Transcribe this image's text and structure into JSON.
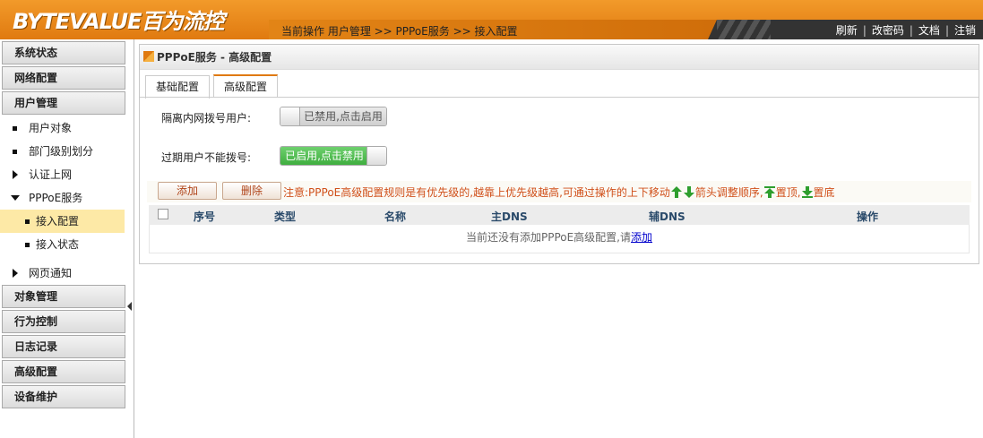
{
  "brand": {
    "logo": "BYTEVALUE百为流控"
  },
  "header": {
    "breadcrumb": "当前操作  用户管理 >> PPPoE服务 >> 接入配置",
    "links": [
      "刷新",
      "改密码",
      "文档",
      "注销"
    ]
  },
  "sidebar": {
    "sections": [
      "系统状态",
      "网络配置",
      "用户管理"
    ],
    "user_items": [
      "用户对象",
      "部门级别划分",
      "认证上网",
      "PPPoE服务"
    ],
    "pppoe_sub": [
      "接入配置",
      "接入状态"
    ],
    "after_item": "网页通知",
    "bottom_sections": [
      "对象管理",
      "行为控制",
      "日志记录",
      "高级配置",
      "设备维护"
    ]
  },
  "panel": {
    "title": "PPPoE服务 - 高级配置",
    "tabs": [
      "基础配置",
      "高级配置"
    ],
    "isolate_label": "隔离内网拨号用户:",
    "isolate_toggle": "已禁用,点击启用",
    "expired_label": "过期用户不能拨号:",
    "expired_toggle": "已启用,点击禁用",
    "add_button": "添加",
    "delete_button": "删除",
    "note_prefix": "注意:PPPoE高级配置规则是有优先级的,越靠上优先级越高,可通过操作的上下移动",
    "note_arrows": "箭头调整顺序,",
    "note_top": "置顶,",
    "note_bottom": "置底",
    "columns": [
      "序号",
      "类型",
      "名称",
      "主DNS",
      "辅DNS",
      "操作"
    ],
    "empty_text": "当前还没有添加PPPoE高级配置,请",
    "empty_link": "添加"
  },
  "colors": {
    "accent": "#e07a10",
    "toggle_on": "#3fae3f",
    "note": "#d0501a"
  }
}
